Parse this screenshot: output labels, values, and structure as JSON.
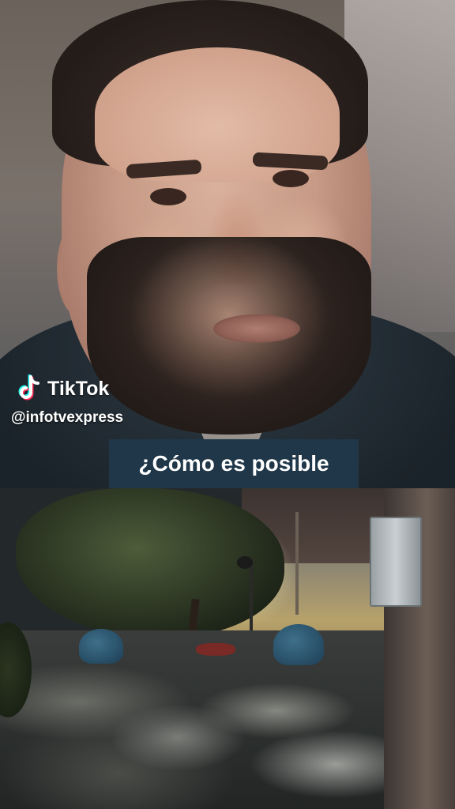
{
  "top_video": {
    "caption": "¿Cómo es posible"
  },
  "watermark": {
    "brand": "TikTok",
    "handle": "@infotvexpress",
    "logo_icon": "tiktok-logo-icon"
  },
  "colors": {
    "caption_bg": "#1f3748",
    "logo_cyan": "#25f4ee",
    "logo_red": "#fe2c55"
  }
}
